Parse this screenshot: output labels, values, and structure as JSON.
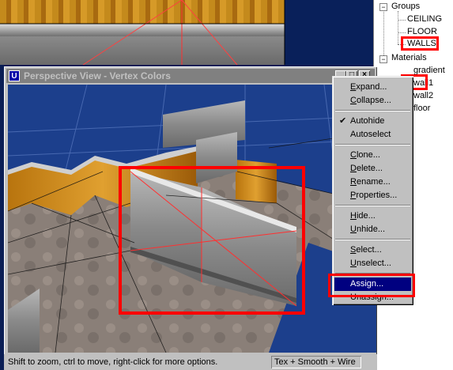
{
  "window": {
    "title": "Perspective View - Vertex Colors",
    "icon_letter": "U",
    "minimize_glyph": "_",
    "maximize_glyph": "□",
    "close_glyph": "×"
  },
  "status_bar": {
    "hint": "Shift to zoom, ctrl to move, right-click for more options.",
    "mode": "Tex + Smooth + Wire"
  },
  "tree": {
    "groups_label": "Groups",
    "groups": [
      "CEILING",
      "FLOOR",
      "WALLS"
    ],
    "materials_label": "Materials",
    "materials": [
      "gradient",
      "wall1",
      "wall2",
      "floor"
    ],
    "expand_glyph": "−"
  },
  "context_menu": {
    "items": [
      {
        "label": "Expand...",
        "u": "E",
        "rest": "xpand..."
      },
      {
        "label": "Collapse...",
        "u": "C",
        "rest": "ollapse..."
      },
      {
        "label": "Autohide",
        "checked": true
      },
      {
        "label": "Autoselect"
      },
      {
        "label": "Clone...",
        "u": "C",
        "rest": "lone..."
      },
      {
        "label": "Delete...",
        "u": "D",
        "rest": "elete..."
      },
      {
        "label": "Rename...",
        "u": "R",
        "rest": "ename..."
      },
      {
        "label": "Properties...",
        "u": "P",
        "rest": "roperties..."
      },
      {
        "label": "Hide...",
        "u": "H",
        "rest": "ide..."
      },
      {
        "label": "Unhide...",
        "u": "U",
        "rest": "nhide..."
      },
      {
        "label": "Select...",
        "u": "S",
        "rest": "elect..."
      },
      {
        "label": "Unselect...",
        "u": "U",
        "rest": "nselect..."
      },
      {
        "label": "Assign...",
        "selected": true
      },
      {
        "label": "Unassign..."
      }
    ],
    "check_glyph": "✔"
  },
  "colors": {
    "highlight": "#ff0000",
    "menu_selection": "#000080",
    "titlebar_inactive": "#808080"
  }
}
